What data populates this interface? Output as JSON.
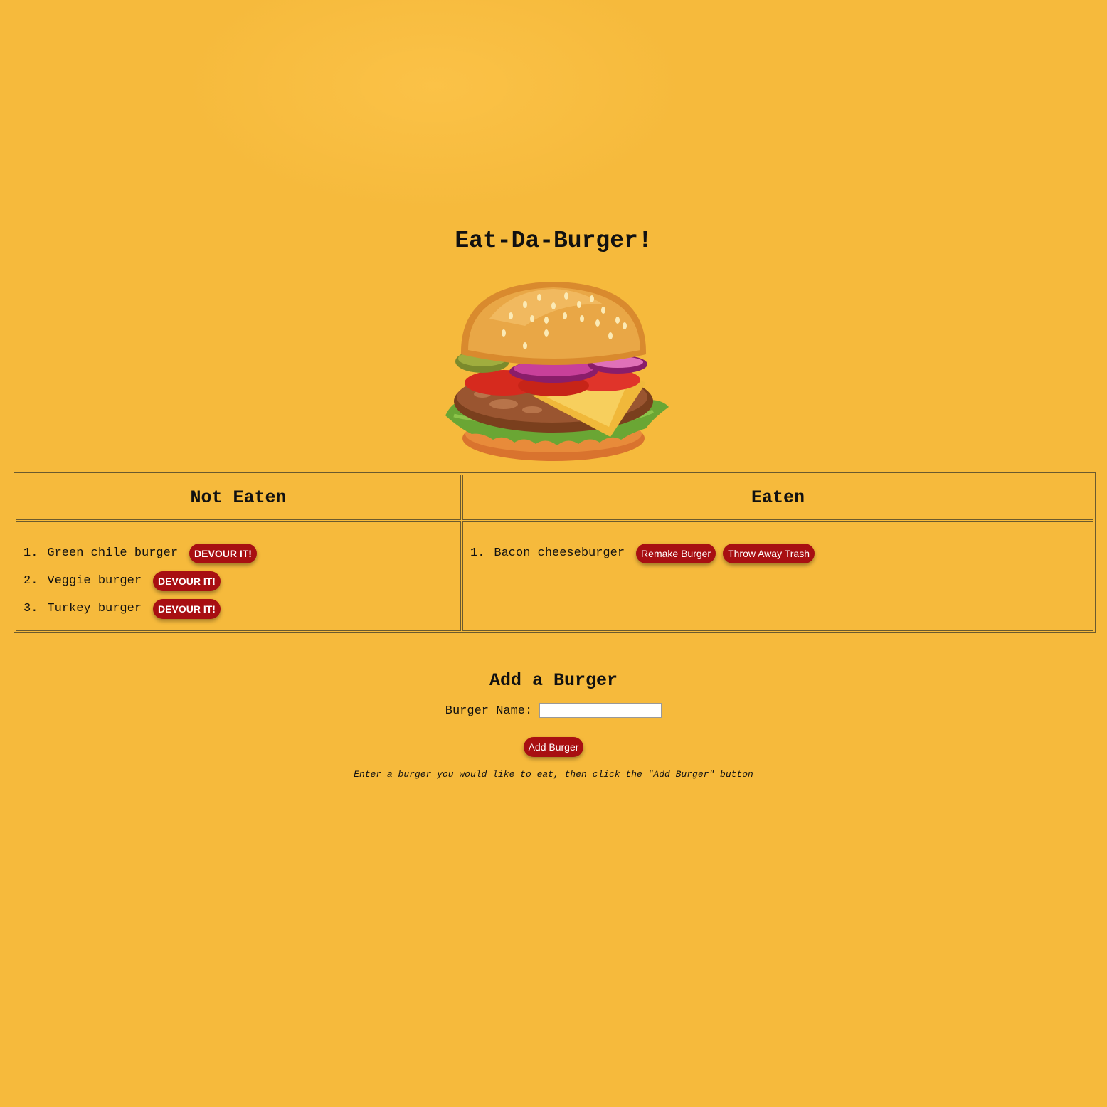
{
  "page": {
    "title": "Eat-Da-Burger!",
    "background_color": "#f6ba3c",
    "button_color": "#a80f12"
  },
  "hero_image": {
    "icon": "hamburger-illustration"
  },
  "table": {
    "not_eaten_header": "Not Eaten",
    "eaten_header": "Eaten",
    "not_eaten": [
      {
        "number": "1.",
        "name": "Green chile burger",
        "button": "DEVOUR IT!"
      },
      {
        "number": "2.",
        "name": "Veggie burger",
        "button": "DEVOUR IT!"
      },
      {
        "number": "3.",
        "name": "Turkey burger",
        "button": "DEVOUR IT!"
      }
    ],
    "eaten": [
      {
        "number": "1.",
        "name": "Bacon cheeseburger",
        "remake_button": "Remake Burger",
        "trash_button": "Throw Away Trash"
      }
    ]
  },
  "add_form": {
    "title": "Add a Burger",
    "name_label": "Burger Name:",
    "name_value": "",
    "submit_label": "Add Burger",
    "hint": "Enter a burger you would like to eat, then click the \"Add Burger\" button"
  }
}
